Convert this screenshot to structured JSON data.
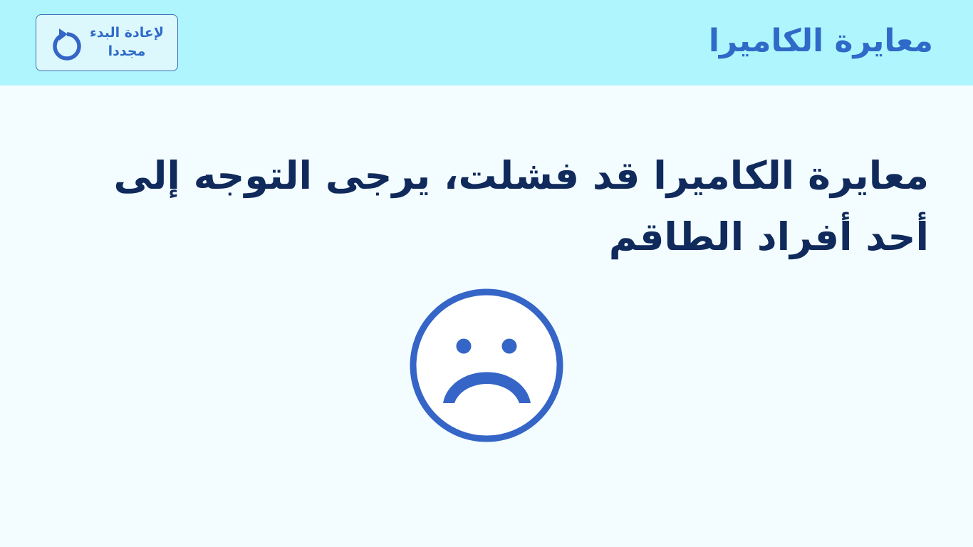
{
  "header": {
    "title": "معايرة الكاميرا",
    "restart_button": {
      "label_line1": "لإعادة البدء",
      "label_line2": "مجددا",
      "icon": "restart-arrow-icon"
    }
  },
  "main": {
    "message": "معايرة الكاميرا قد فشلت، يرجى التوجه إلى أحد أفراد الطاقم",
    "icon": "sad-face-icon"
  },
  "colors": {
    "header_background": "#aef5fd",
    "page_background": "#f3fdff",
    "accent": "#2f6ac8",
    "message_text": "#102a5c",
    "icon": "#3565c6"
  }
}
